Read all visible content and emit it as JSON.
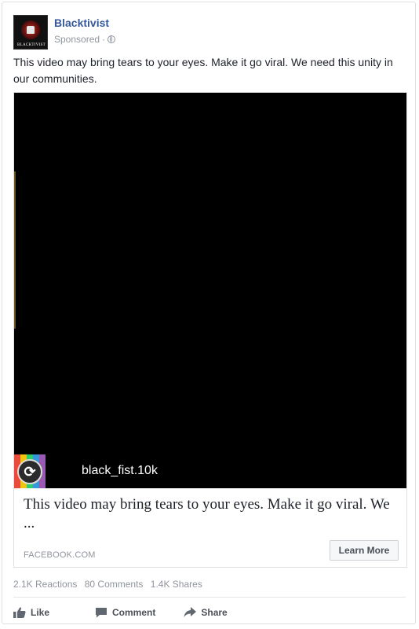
{
  "post": {
    "page_name": "Blacktivist",
    "sponsored_label": "Sponsored",
    "separator": "·",
    "avatar_text": "BLACKTIVIST",
    "text": "This video may bring tears to your eyes. Make it go viral. We need this unity in our communities."
  },
  "media": {
    "username": "black_fist.10k",
    "link_title": "This video may bring tears to your eyes. Make it go viral. We ...",
    "link_domain": "FACEBOOK.COM",
    "cta_label": "Learn More"
  },
  "stats": {
    "reactions": "2.1K Reactions",
    "comments": "80 Comments",
    "shares": "1.4K Shares"
  },
  "actions": {
    "like": "Like",
    "comment": "Comment",
    "share": "Share"
  },
  "colors": {
    "link_blue": "#365899",
    "meta_gray": "#90949c"
  }
}
